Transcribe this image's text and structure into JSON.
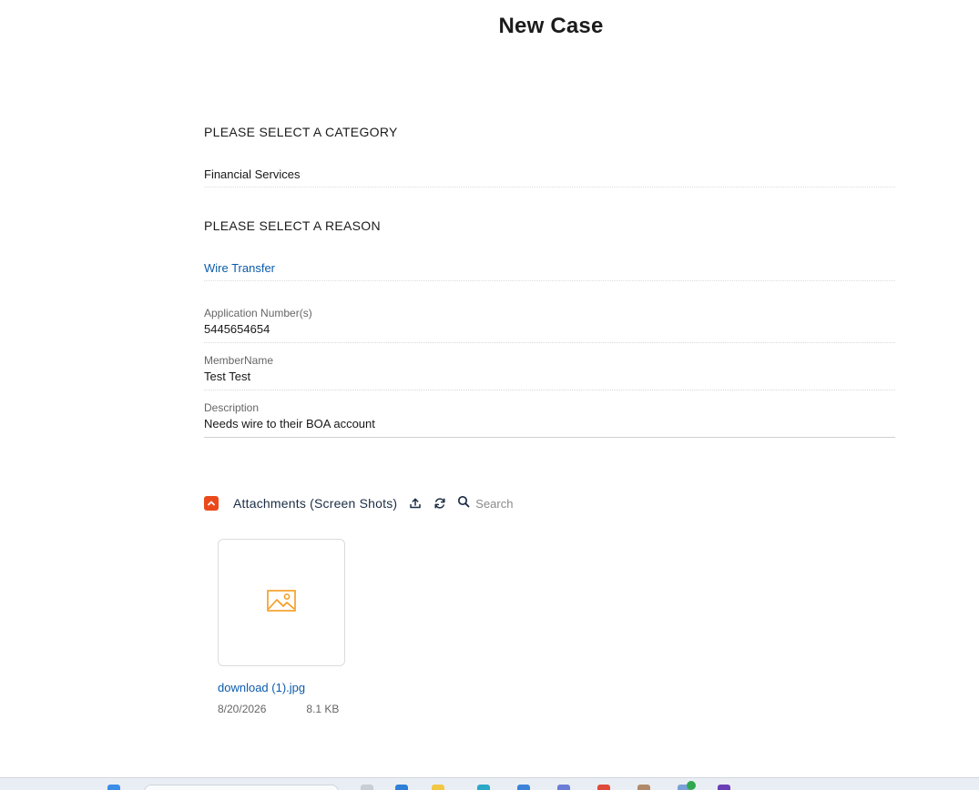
{
  "page": {
    "title": "New Case"
  },
  "category": {
    "heading": "PLEASE SELECT A CATEGORY",
    "value": "Financial Services"
  },
  "reason": {
    "heading": "PLEASE SELECT A REASON",
    "value": "Wire Transfer"
  },
  "fields": {
    "application_number": {
      "label": "Application Number(s)",
      "value": "5445654654"
    },
    "member_name": {
      "label": "MemberName",
      "value": "Test Test"
    },
    "description": {
      "label": "Description",
      "value": "Needs wire to their BOA account"
    }
  },
  "attachments": {
    "title": "Attachments (Screen Shots)",
    "search_placeholder": "Search",
    "files": [
      {
        "name": "download (1).jpg",
        "date": "8/20/2026",
        "size": "8.1 KB"
      }
    ]
  },
  "colors": {
    "accent": "#ea4a1b",
    "link": "#0b5cab",
    "image_icon": "#f59b1f"
  },
  "icons": {
    "collapse": "chevron-up-icon",
    "upload": "upload-icon",
    "refresh": "refresh-icon",
    "search": "search-icon",
    "image": "image-icon"
  }
}
